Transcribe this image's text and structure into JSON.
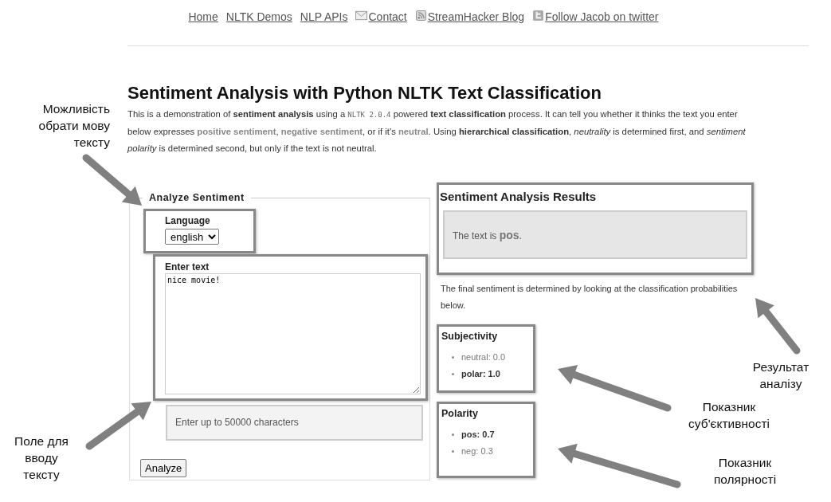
{
  "nav": [
    {
      "label": "Home"
    },
    {
      "label": "NLTK Demos"
    },
    {
      "label": "NLP APIs"
    },
    {
      "label": "Contact"
    },
    {
      "label": "StreamHacker Blog"
    },
    {
      "label": "Follow Jacob on twitter"
    }
  ],
  "title": "Sentiment Analysis with Python NLTK Text Classification",
  "intro": [
    {
      "kind": "plain",
      "text": "This is a demonstration of "
    },
    {
      "kind": "bold",
      "text": "sentiment analysis"
    },
    {
      "kind": "plain",
      "text": " using a "
    },
    {
      "kind": "code",
      "text": "NLTK 2.0.4"
    },
    {
      "kind": "plain",
      "text": " powered "
    },
    {
      "kind": "bold",
      "text": "text classification"
    },
    {
      "kind": "plain",
      "text": " process. It can tell you whether it thinks the text you enter below expresses "
    },
    {
      "kind": "term",
      "text": "positive sentiment"
    },
    {
      "kind": "plain",
      "text": ", "
    },
    {
      "kind": "term",
      "text": "negative sentiment"
    },
    {
      "kind": "plain",
      "text": ", or if it's "
    },
    {
      "kind": "term",
      "text": "neutral"
    },
    {
      "kind": "plain",
      "text": ". Using "
    },
    {
      "kind": "bold",
      "text": "hierarchical classification"
    },
    {
      "kind": "plain",
      "text": ", "
    },
    {
      "kind": "italic",
      "text": "neutrality"
    },
    {
      "kind": "plain",
      "text": " is determined first, and "
    },
    {
      "kind": "italic",
      "text": "sentiment polarity"
    },
    {
      "kind": "plain",
      "text": " is determined second, but only if the text is not neutral."
    }
  ],
  "form": {
    "legend": "Analyze Sentiment",
    "language_label": "Language",
    "language": "english",
    "text_label": "Enter text",
    "text": "nice movie!",
    "hint": "Enter up to 50000 characters",
    "button": "Analyze"
  },
  "results": {
    "title": "Sentiment Analysis Results",
    "verdict": "The text is **pos**.",
    "note": "The final sentiment is determined by looking at the classification probabilities below."
  },
  "subjectivity": {
    "title": "Subjectivity",
    "items": [
      {
        "label": "neutral: 0.0",
        "bold": false
      },
      {
        "label": "polar: 1.0",
        "bold": true
      }
    ]
  },
  "polarity": {
    "title": "Polarity",
    "items": [
      {
        "label": "pos: 0.7",
        "bold": true
      },
      {
        "label": "neg: 0.3",
        "bold": false
      }
    ]
  },
  "annotations": [
    {
      "text": "Можливість\nобрати мову\nтексту"
    },
    {
      "text": "Поле для\nвводу\nтексту"
    },
    {
      "text": "Результат\nаналізу"
    },
    {
      "text": "Показник\nсуб'єктивності"
    },
    {
      "text": "Показник\nполярності"
    }
  ]
}
